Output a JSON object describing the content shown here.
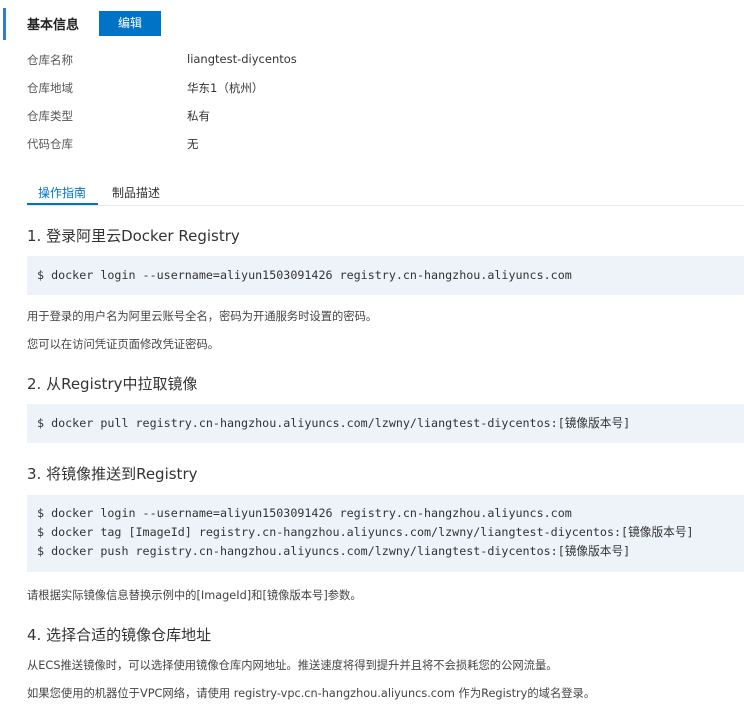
{
  "header": {
    "title": "基本信息",
    "edit_label": "编辑"
  },
  "info": [
    {
      "label": "仓库名称",
      "value": "liangtest-diycentos"
    },
    {
      "label": "仓库地域",
      "value": "华东1（杭州）"
    },
    {
      "label": "仓库类型",
      "value": "私有"
    },
    {
      "label": "代码仓库",
      "value": "无"
    }
  ],
  "tabs": [
    {
      "label": "操作指南",
      "active": true
    },
    {
      "label": "制品描述",
      "active": false
    }
  ],
  "guide": {
    "step1": {
      "title": "1. 登录阿里云Docker Registry",
      "code": [
        "$ docker login --username=aliyun1503091426 registry.cn-hangzhou.aliyuncs.com"
      ],
      "notes": [
        "用于登录的用户名为阿里云账号全名，密码为开通服务时设置的密码。",
        "您可以在访问凭证页面修改凭证密码。"
      ]
    },
    "step2": {
      "title": "2. 从Registry中拉取镜像",
      "code": [
        "$ docker pull registry.cn-hangzhou.aliyuncs.com/lzwny/liangtest-diycentos:[镜像版本号]"
      ]
    },
    "step3": {
      "title": "3. 将镜像推送到Registry",
      "code": [
        "$ docker login --username=aliyun1503091426 registry.cn-hangzhou.aliyuncs.com",
        "$ docker tag [ImageId] registry.cn-hangzhou.aliyuncs.com/lzwny/liangtest-diycentos:[镜像版本号]",
        "$ docker push registry.cn-hangzhou.aliyuncs.com/lzwny/liangtest-diycentos:[镜像版本号]"
      ],
      "notes": [
        "请根据实际镜像信息替换示例中的[ImageId]和[镜像版本号]参数。"
      ]
    },
    "step4": {
      "title": "4. 选择合适的镜像仓库地址",
      "notes": [
        "从ECS推送镜像时，可以选择使用镜像仓库内网地址。推送速度将得到提升并且将不会损耗您的公网流量。",
        "如果您使用的机器位于VPC网络，请使用 registry-vpc.cn-hangzhou.aliyuncs.com 作为Registry的域名登录。"
      ]
    }
  },
  "colors": {
    "accent": "#0073c7",
    "code_bg": "#eef3f9",
    "tab_border": "#e3e6ea"
  }
}
